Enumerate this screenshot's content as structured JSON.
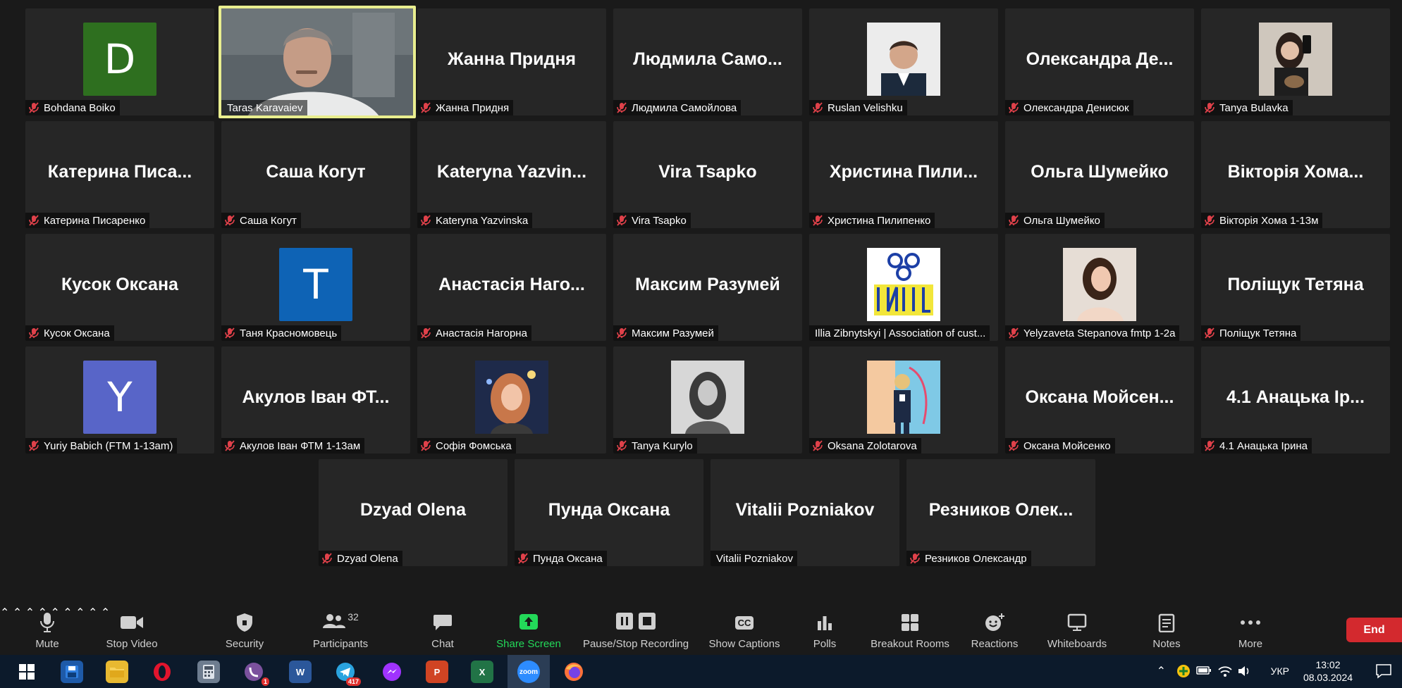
{
  "participants": [
    {
      "label": "Bohdana Boiko",
      "muted": true,
      "type": "initial",
      "initial": "D",
      "color": "#2e6f1f"
    },
    {
      "label": "Taras Karavaiev",
      "muted": false,
      "type": "video",
      "speaker": true
    },
    {
      "label": "Жанна Придня",
      "muted": true,
      "type": "name",
      "display": "Жанна Придня"
    },
    {
      "label": "Людмила Самойлова",
      "muted": true,
      "type": "name",
      "display": "Людмила Само..."
    },
    {
      "label": "Ruslan Velishku",
      "muted": true,
      "type": "photo",
      "photo": "man-portrait"
    },
    {
      "label": "Олександра Денисюк",
      "muted": true,
      "type": "name",
      "display": "Олександра Де..."
    },
    {
      "label": "Tanya Bulavka",
      "muted": true,
      "type": "photo",
      "photo": "woman-selfie"
    },
    {
      "label": "Катерина Писаренко",
      "muted": true,
      "type": "name",
      "display": "Катерина Писа..."
    },
    {
      "label": "Саша Когут",
      "muted": true,
      "type": "name",
      "display": "Саша Когут"
    },
    {
      "label": "Kateryna Yazvinska",
      "muted": true,
      "type": "name",
      "display": "Kateryna Yazvin..."
    },
    {
      "label": "Vira Tsapko",
      "muted": true,
      "type": "name",
      "display": "Vira Tsapko"
    },
    {
      "label": "Христина Пилипенко",
      "muted": true,
      "type": "name",
      "display": "Христина Пили..."
    },
    {
      "label": "Ольга Шумейко",
      "muted": true,
      "type": "name",
      "display": "Ольга Шумейко"
    },
    {
      "label": "Вікторія Хома 1-13м",
      "muted": true,
      "type": "name",
      "display": "Вікторія Хома..."
    },
    {
      "label": "Кусок Оксана",
      "muted": true,
      "type": "name",
      "display": "Кусок Оксана"
    },
    {
      "label": "Таня Красномовець",
      "muted": true,
      "type": "initial",
      "initial": "T",
      "color": "#0e63b5"
    },
    {
      "label": "Анастасія Нагорна",
      "muted": true,
      "type": "name",
      "display": "Анастасія Наго..."
    },
    {
      "label": "Максим Разумей",
      "muted": true,
      "type": "name",
      "display": "Максим Разумей"
    },
    {
      "label": "Illia Zibnytskyi | Association of cust...",
      "muted": false,
      "type": "photo",
      "photo": "logo"
    },
    {
      "label": "Yelyzaveta Stepanova fmtp 1-2a",
      "muted": true,
      "type": "photo",
      "photo": "woman-portrait"
    },
    {
      "label": "Поліщук Тетяна",
      "muted": true,
      "type": "name",
      "display": "Поліщук Тетяна"
    },
    {
      "label": "Yuriy Babich (FTM 1-13am)",
      "muted": true,
      "type": "initial",
      "initial": "Y",
      "color": "#5865c8"
    },
    {
      "label": "Акулов Іван ФТМ 1-13ам",
      "muted": true,
      "type": "name",
      "display": "Акулов Іван ФТ..."
    },
    {
      "label": "Софія Фомська",
      "muted": true,
      "type": "photo",
      "photo": "woman-night"
    },
    {
      "label": "Tanya Kurylo",
      "muted": true,
      "type": "photo",
      "photo": "woman-bw"
    },
    {
      "label": "Oksana Zolotarova",
      "muted": true,
      "type": "photo",
      "photo": "woman-stage"
    },
    {
      "label": "Оксана Мойсенко",
      "muted": true,
      "type": "name",
      "display": "Оксана Мойсен..."
    },
    {
      "label": "4.1 Анацька Ірина",
      "muted": true,
      "type": "name",
      "display": "4.1 Анацька Ір..."
    },
    {
      "label": "Dzyad Olena",
      "muted": true,
      "type": "name",
      "display": "Dzyad Olena"
    },
    {
      "label": "Пунда Оксана",
      "muted": true,
      "type": "name",
      "display": "Пунда Оксана"
    },
    {
      "label": "Vitalii Pozniakov",
      "muted": false,
      "type": "name",
      "display": "Vitalii Pozniakov"
    },
    {
      "label": "Резников Олександр",
      "muted": true,
      "type": "name",
      "display": "Резников Олек..."
    }
  ],
  "toolbar": {
    "mute": "Mute",
    "stop_video": "Stop Video",
    "security": "Security",
    "participants": "Participants",
    "participants_count": "32",
    "chat": "Chat",
    "share_screen": "Share Screen",
    "record": "Pause/Stop Recording",
    "captions": "Show Captions",
    "captions_icon": "CC",
    "polls": "Polls",
    "breakout": "Breakout Rooms",
    "reactions": "Reactions",
    "whiteboards": "Whiteboards",
    "notes": "Notes",
    "more": "More",
    "end": "End",
    "colors": {
      "share_green": "#23d959",
      "end_red": "#d3292e"
    }
  },
  "taskbar": {
    "word": "W",
    "powerpoint": "P",
    "excel": "X",
    "zoom": "zoom",
    "viber_badge": "1",
    "telegram_badge": "417",
    "language": "УКР",
    "time": "13:02",
    "date": "08.03.2024"
  }
}
